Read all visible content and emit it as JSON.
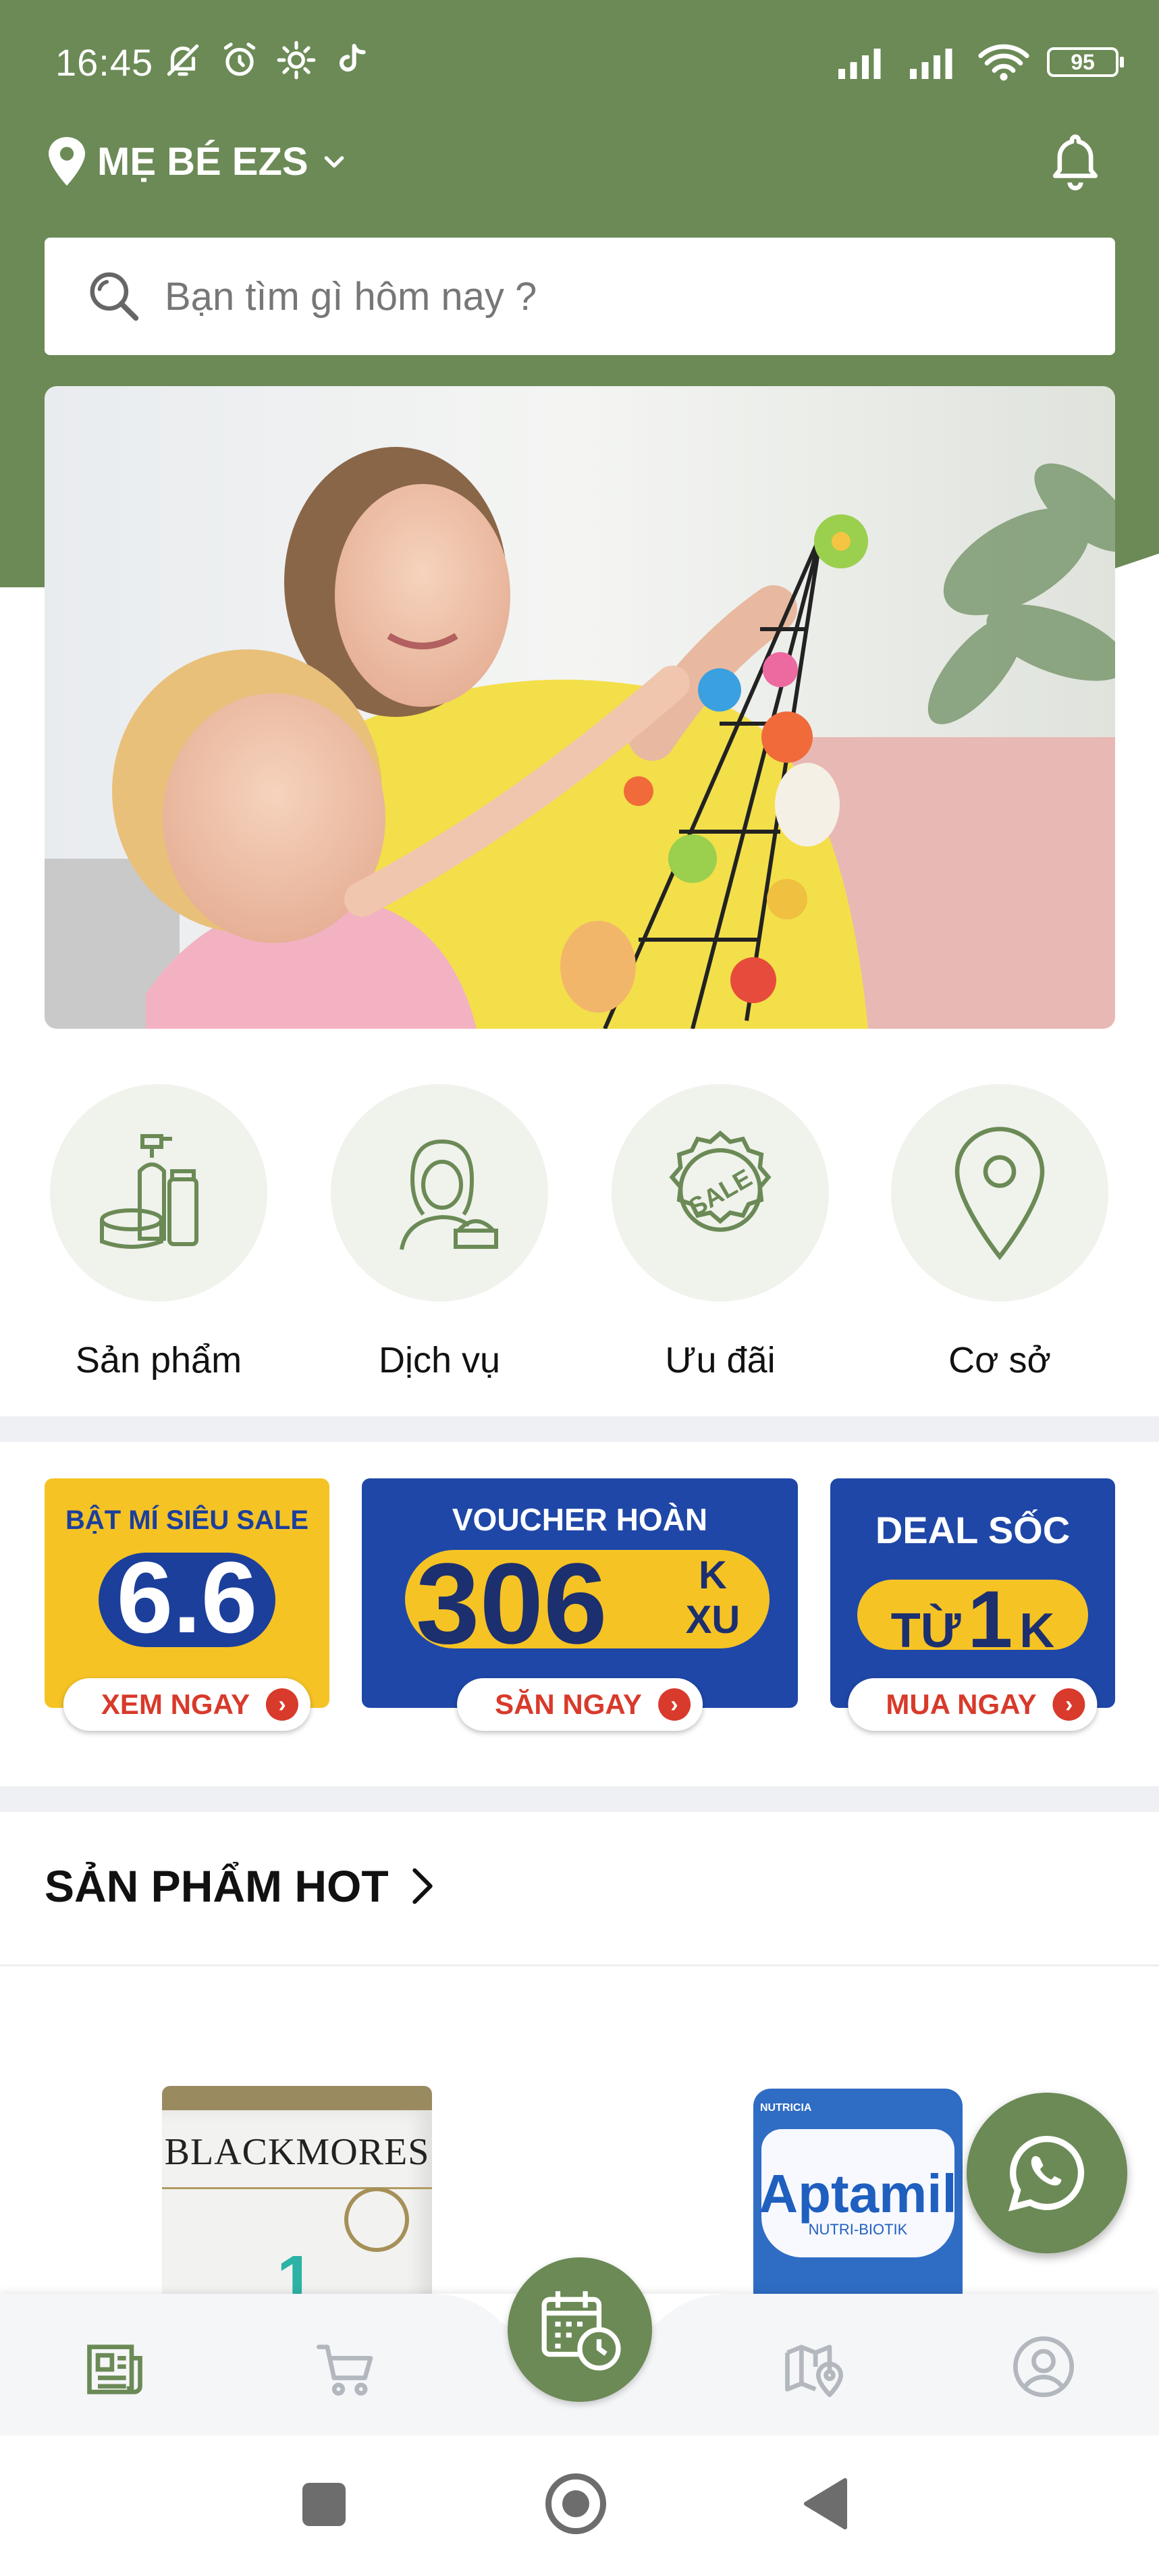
{
  "colors": {
    "brand": "#6b8a56",
    "header_bg": "#6b8a56",
    "promo_red": "#d83a2b",
    "divider": "#eef0f4"
  },
  "status_bar": {
    "time": "16:45",
    "battery": "95"
  },
  "header": {
    "location_label": "MẸ BÉ EZS",
    "search_placeholder": "Bạn tìm gì hôm nay ?"
  },
  "categories": [
    {
      "label": "Sản phẩm",
      "icon": "cosmetics-icon"
    },
    {
      "label": "Dịch vụ",
      "icon": "beauty-service-icon"
    },
    {
      "label": "Ưu đãi",
      "icon": "sale-badge-icon"
    },
    {
      "label": "Cơ sở",
      "icon": "location-pin-icon"
    }
  ],
  "promos": [
    {
      "top_text": "BẬT MÍ SIÊU SALE",
      "big_text": "6.6",
      "button": "XEM NGAY"
    },
    {
      "top_text": "VOUCHER HOÀN",
      "big_text": "306",
      "suffix_top": "K",
      "suffix_bottom": "XU",
      "button": "SĂN NGAY"
    },
    {
      "top_text": "DEAL SỐC",
      "big_text_a": "TỪ",
      "big_text_b": "1",
      "big_text_c": "K",
      "button": "MUA NGAY"
    }
  ],
  "hot_section": {
    "title": "SẢN PHẨM HOT"
  },
  "products": [
    {
      "brand": "BLACKMORES",
      "stage": "1"
    },
    {
      "brand": "Aptamil",
      "sub": "NUTRI-BIOTIK",
      "maker": "NUTRICIA"
    }
  ],
  "bottom_nav": [
    "news-icon",
    "cart-icon",
    "calendar-clock-icon",
    "map-icon",
    "account-icon"
  ]
}
